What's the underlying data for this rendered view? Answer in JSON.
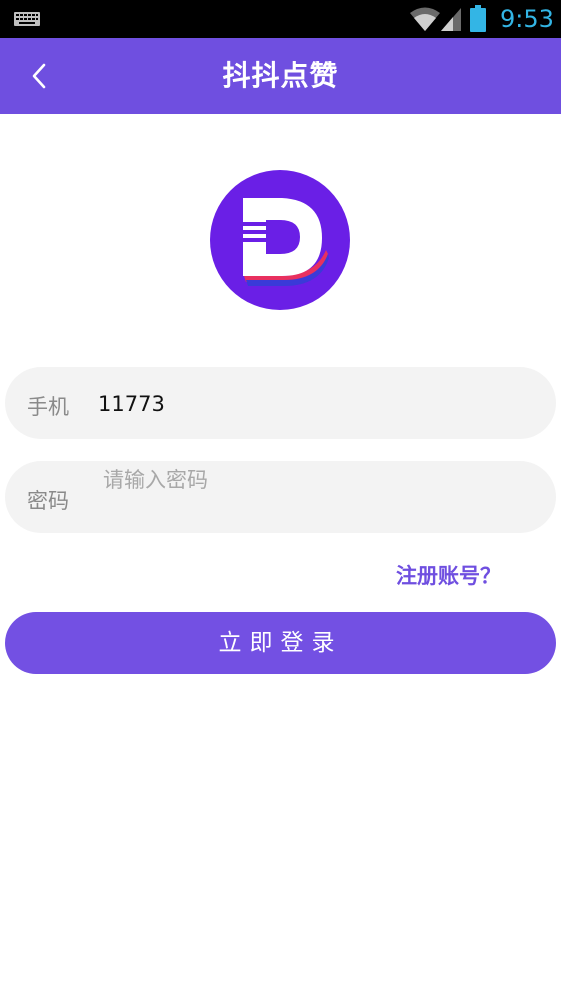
{
  "status_bar": {
    "time": "9:53",
    "icons": [
      "keyboard-icon",
      "wifi-icon",
      "signal-icon",
      "battery-icon"
    ],
    "time_color": "#33b5e5"
  },
  "app_bar": {
    "title": "抖抖点赞",
    "back_icon": "chevron-left-icon",
    "background": "#6f4fe0"
  },
  "logo": {
    "icon": "d-logo-icon",
    "color": "#6a1fe6"
  },
  "form": {
    "phone": {
      "label": "手机",
      "value": "11773"
    },
    "password": {
      "label": "密码",
      "placeholder": "请输入密码"
    },
    "register_link": "注册账号？",
    "login_button": "立即登录"
  },
  "colors": {
    "accent": "#7350e3",
    "field_bg": "#f3f3f3"
  }
}
